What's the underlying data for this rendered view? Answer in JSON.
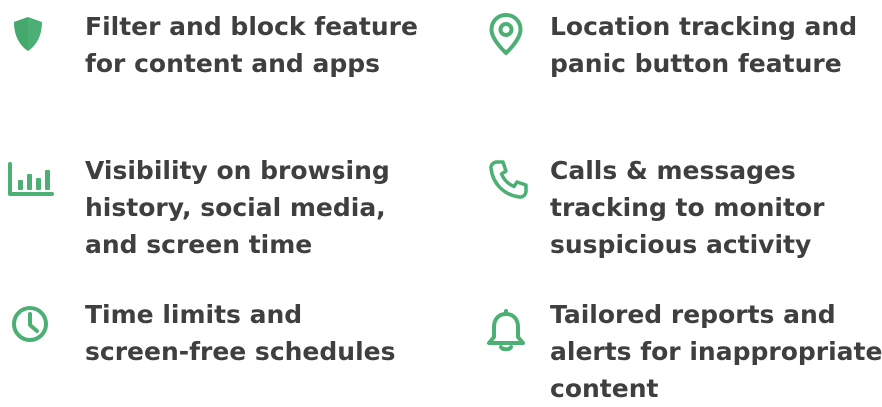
{
  "accent_color": "#4caf73",
  "text_color": "#3f3f3f",
  "features": [
    {
      "icon": "shield-icon",
      "lines": [
        "Filter and block feature",
        "for content and apps"
      ]
    },
    {
      "icon": "location-pin-icon",
      "lines": [
        "Location tracking and",
        "panic button feature"
      ]
    },
    {
      "icon": "bar-chart-icon",
      "lines": [
        "Visibility on browsing",
        "history, social media,",
        "and screen time"
      ]
    },
    {
      "icon": "phone-icon",
      "lines": [
        "Calls & messages",
        "tracking to monitor",
        "suspicious activity"
      ]
    },
    {
      "icon": "clock-icon",
      "lines": [
        "Time limits and",
        "screen-free schedules"
      ]
    },
    {
      "icon": "bell-icon",
      "lines": [
        "Tailored reports and",
        "alerts for inappropriate",
        "content"
      ]
    }
  ]
}
